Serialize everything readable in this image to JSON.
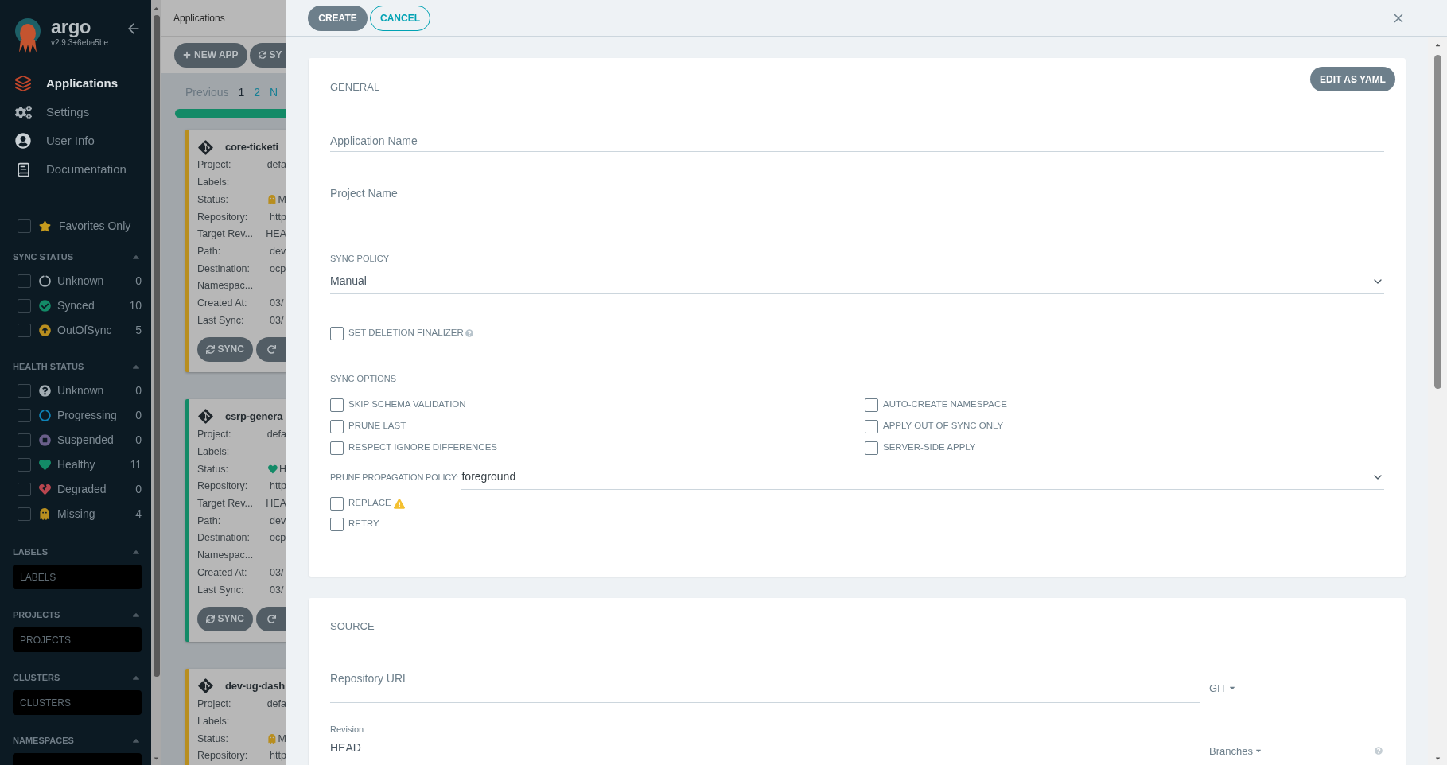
{
  "sidebar": {
    "logo": {
      "name": "argo",
      "version": "v2.9.3+6eba5be"
    },
    "nav": [
      {
        "label": "Applications",
        "selected": true
      },
      {
        "label": "Settings",
        "selected": false
      },
      {
        "label": "User Info",
        "selected": false
      },
      {
        "label": "Documentation",
        "selected": false
      }
    ],
    "favorites": {
      "label": "Favorites Only",
      "checked": false
    },
    "filters": [
      {
        "title": "SYNC STATUS",
        "kind": "checklist",
        "items": [
          {
            "label": "Unknown",
            "count": "0",
            "checked": false
          },
          {
            "label": "Synced",
            "count": "10",
            "checked": false
          },
          {
            "label": "OutOfSync",
            "count": "5",
            "checked": false
          }
        ]
      },
      {
        "title": "HEALTH STATUS",
        "kind": "health",
        "items": [
          {
            "label": "Unknown",
            "count": "0",
            "checked": false
          },
          {
            "label": "Progressing",
            "count": "0",
            "checked": false
          },
          {
            "label": "Suspended",
            "count": "0",
            "checked": false
          },
          {
            "label": "Healthy",
            "count": "11",
            "checked": false
          },
          {
            "label": "Degraded",
            "count": "0",
            "checked": false
          },
          {
            "label": "Missing",
            "count": "4",
            "checked": false
          }
        ]
      },
      {
        "title": "LABELS",
        "kind": "input",
        "placeholder": "LABELS"
      },
      {
        "title": "PROJECTS",
        "kind": "input",
        "placeholder": "PROJECTS"
      },
      {
        "title": "CLUSTERS",
        "kind": "input",
        "placeholder": "CLUSTERS"
      },
      {
        "title": "NAMESPACES",
        "kind": "input"
      }
    ]
  },
  "apps": {
    "title": "Applications",
    "toolbar": [
      "NEW APP",
      "SY"
    ],
    "pagination": {
      "previous": "Previous",
      "pages": [
        {
          "label": "1",
          "selected": true
        },
        {
          "label": "2",
          "selected": false
        }
      ],
      "next": "N"
    },
    "cards": [
      {
        "title": "core-ticketi",
        "color": "#b88e1f",
        "kind": "missing",
        "fields": [
          {
            "label": "Project:",
            "value": "defa"
          },
          {
            "label": "Labels:"
          },
          {
            "label": "Status:",
            "value": "M"
          },
          {
            "label": "Repository:",
            "value": "http"
          },
          {
            "label": "Target Rev...",
            "value": "HEA"
          },
          {
            "label": "Path:",
            "value": "dev"
          },
          {
            "label": "Destination:",
            "value": "ocp"
          },
          {
            "label": "Namespac..."
          },
          {
            "label": "Created At:",
            "value": "03/"
          },
          {
            "label": "Last Sync:",
            "value": "03/"
          }
        ],
        "button": "SYNC"
      },
      {
        "title": "csrp-genera",
        "color": "#138a67",
        "kind": "healthy",
        "fields": [
          {
            "label": "Project:",
            "value": "defa"
          },
          {
            "label": "Labels:"
          },
          {
            "label": "Status:",
            "value": "H"
          },
          {
            "label": "Repository:",
            "value": "http"
          },
          {
            "label": "Target Rev...",
            "value": "HEA"
          },
          {
            "label": "Path:",
            "value": "dev"
          },
          {
            "label": "Destination:",
            "value": "ocp"
          },
          {
            "label": "Namespac..."
          },
          {
            "label": "Created At:",
            "value": "03/"
          },
          {
            "label": "Last Sync:",
            "value": "03/"
          }
        ],
        "button": "SYNC"
      },
      {
        "title": "dev-ug-dash",
        "color": "#b88e1f",
        "kind": "missing",
        "fields": [
          {
            "label": "Project:",
            "value": "defa"
          },
          {
            "label": "Labels:"
          },
          {
            "label": "Status:",
            "value": "M"
          },
          {
            "label": "Repository:",
            "value": "http"
          }
        ]
      }
    ]
  },
  "panel": {
    "buttons": {
      "create": "CREATE",
      "cancel": "CANCEL"
    },
    "general": {
      "title": "GENERAL",
      "edit_button": "EDIT AS YAML",
      "application_name": {
        "placeholder": "Application Name"
      },
      "project_name": {
        "placeholder": "Project Name"
      },
      "sync_policy": {
        "label": "SYNC POLICY",
        "value": "Manual"
      },
      "deletion_finalizer": {
        "label": "SET DELETION FINALIZER",
        "checked": false
      },
      "sync_options": {
        "title": "SYNC OPTIONS",
        "items": [
          {
            "label": "SKIP SCHEMA VALIDATION",
            "checked": false
          },
          {
            "label": "AUTO-CREATE NAMESPACE",
            "checked": false
          },
          {
            "label": "PRUNE LAST",
            "checked": false
          },
          {
            "label": "APPLY OUT OF SYNC ONLY",
            "checked": false
          },
          {
            "label": "RESPECT IGNORE DIFFERENCES",
            "checked": false
          },
          {
            "label": "SERVER-SIDE APPLY",
            "checked": false
          }
        ]
      },
      "prune_policy": {
        "label": "PRUNE PROPAGATION POLICY:",
        "value": "foreground"
      },
      "extra_options": [
        {
          "label": "REPLACE",
          "checked": false,
          "kind": "warning"
        },
        {
          "label": "RETRY",
          "checked": false,
          "kind": "plain"
        }
      ]
    },
    "source": {
      "title": "SOURCE",
      "repository_url": {
        "placeholder": "Repository URL"
      },
      "repo_type": "GIT",
      "revision": {
        "label": "Revision",
        "value": "HEAD"
      },
      "revision_type": "Branches"
    }
  }
}
